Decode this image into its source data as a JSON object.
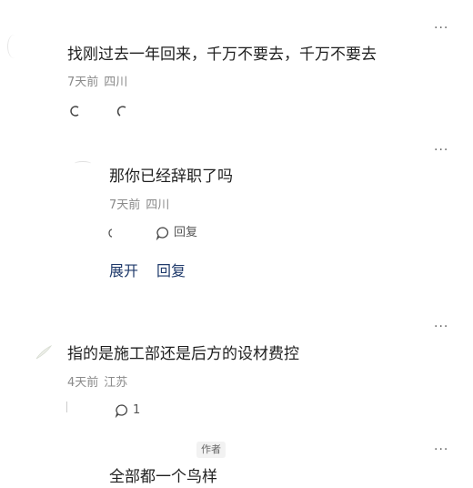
{
  "comments": [
    {
      "text": "找刚过去一年回来，千万不要去，千万不要去",
      "time": "7天前",
      "location": "四川",
      "more": "···"
    },
    {
      "text": "那你已经辞职了吗",
      "time": "7天前",
      "location": "四川",
      "reply_label": "回复",
      "expand_label_1": "展开",
      "expand_label_2": "回复",
      "more": "···"
    },
    {
      "text": "指的是施工部还是后方的设材费控",
      "time": "4天前",
      "location": "江苏",
      "reply_count": "1",
      "more": "···"
    },
    {
      "author_tag": "作者",
      "text": "全部都一个鸟样",
      "more": "···"
    }
  ]
}
